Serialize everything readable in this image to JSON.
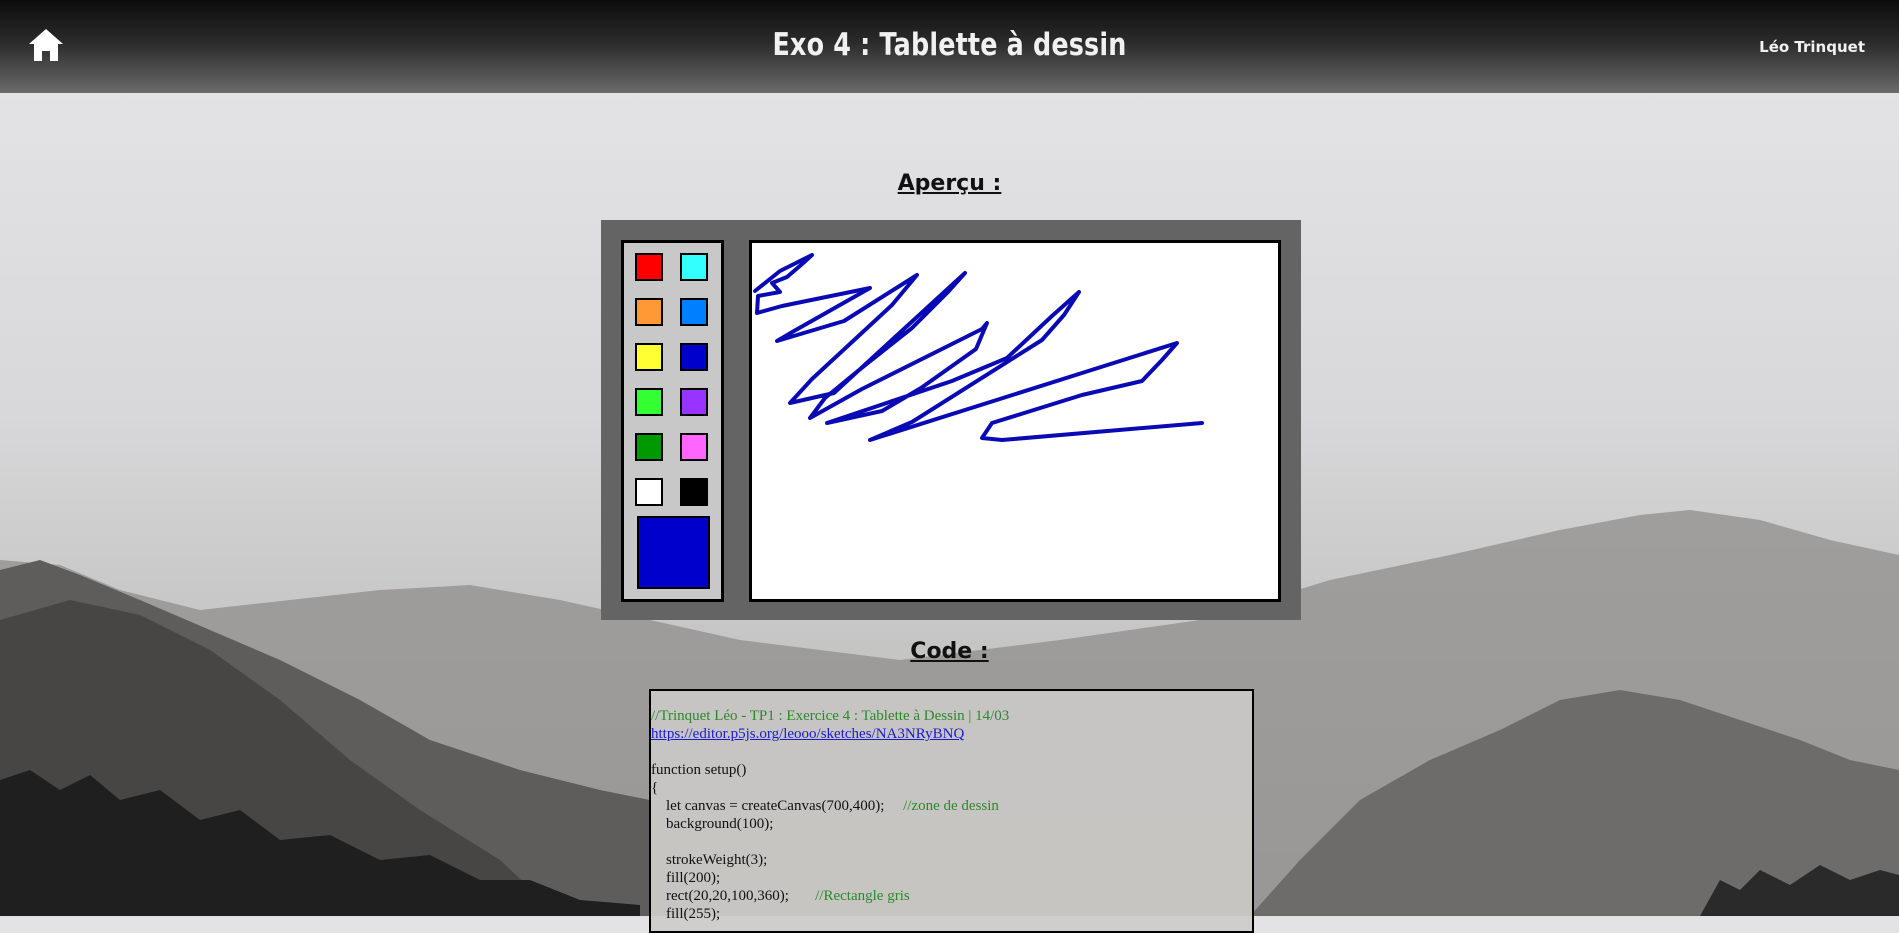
{
  "header": {
    "title": "Exo 4 : Tablette à dessin",
    "author": "Léo Trinquet",
    "home_icon": "home-icon"
  },
  "preview": {
    "heading": "Aperçu :",
    "palette": [
      "#ff0000",
      "#33ffff",
      "#ff9933",
      "#0080ff",
      "#ffff33",
      "#0000cc",
      "#33ff33",
      "#9933ff",
      "#009900",
      "#ff66ff",
      "#ffffff",
      "#000000"
    ],
    "selected_color": "#0000cc",
    "stroke_color": "#0a0ab4"
  },
  "code": {
    "heading": "Code :",
    "comment_line": "//Trinquet Léo - TP1 : Exercice 4 : Tablette à Dessin | 14/03",
    "link": "https://editor.p5js.org/leooo/sketches/NA3NRyBNQ",
    "line_func": "function setup()",
    "line_brace": "{",
    "line_canvas": "    let canvas = createCanvas(700,400);",
    "line_canvas_comment": "//zone de dessin",
    "line_bg": "    background(100);",
    "line_stroke": "    strokeWeight(3);",
    "line_fill200": "    fill(200);",
    "line_rect": "    rect(20,20,100,360);",
    "line_rect_comment": "//Rectangle gris",
    "line_fill255": "    fill(255);"
  }
}
